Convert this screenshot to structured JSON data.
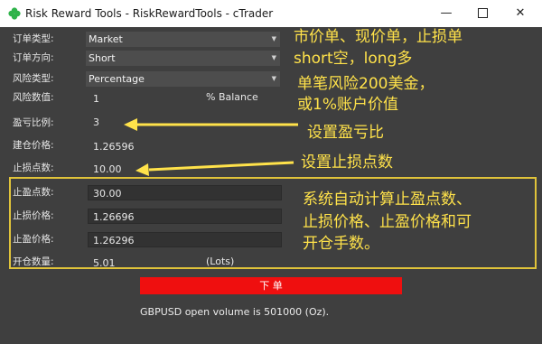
{
  "window": {
    "title": "Risk Reward Tools - RiskRewardTools - cTrader",
    "minimize_glyph": "—",
    "close_glyph": "✕"
  },
  "form": {
    "order_type": {
      "label": "订单类型:",
      "value": "Market"
    },
    "direction": {
      "label": "订单方向:",
      "value": "Short"
    },
    "risk_type": {
      "label": "风险类型:",
      "value": "Percentage"
    },
    "risk_value": {
      "label": "风险数值:",
      "value": "1",
      "unit": "% Balance"
    },
    "profit_ratio": {
      "label": "盈亏比例:",
      "value": "3"
    },
    "entry_price": {
      "label": "建仓价格:",
      "value": "1.26596"
    },
    "stop_points": {
      "label": "止损点数:",
      "value": "10.00"
    },
    "take_points": {
      "label": "止盈点数:",
      "value": "30.00"
    },
    "stop_price": {
      "label": "止损价格:",
      "value": "1.26696"
    },
    "take_price": {
      "label": "止盈价格:",
      "value": "1.26296"
    },
    "volume": {
      "label": "开仓数量:",
      "value": "5.01",
      "unit": "(Lots)"
    }
  },
  "order_button": {
    "label": "下 单"
  },
  "status": {
    "text": "GBPUSD open volume is 501000 (Oz)."
  },
  "annotations": {
    "line1": "市价单、现价单，止损单",
    "line2": "short空，long多",
    "line3": "单笔风险200美金，",
    "line4": "或1%账户价值",
    "ratio_note": "设置盈亏比",
    "stop_note": "设置止损点数",
    "auto_line1": "系统自动计算止盈点数、",
    "auto_line2": "止损价格、止盈价格和可",
    "auto_line3": "开仓手数。"
  },
  "icons": {
    "app": "ctrader-clover-icon",
    "dropdown": "chevron-down-icon",
    "annotation_arrow": "arrow-left-icon"
  },
  "colors": {
    "background": "#3f3f3f",
    "annotation": "#ffe24a",
    "order_button": "#ef0f0f",
    "app_icon": "#2fb34a",
    "highlight_border": "#e0c33a"
  }
}
